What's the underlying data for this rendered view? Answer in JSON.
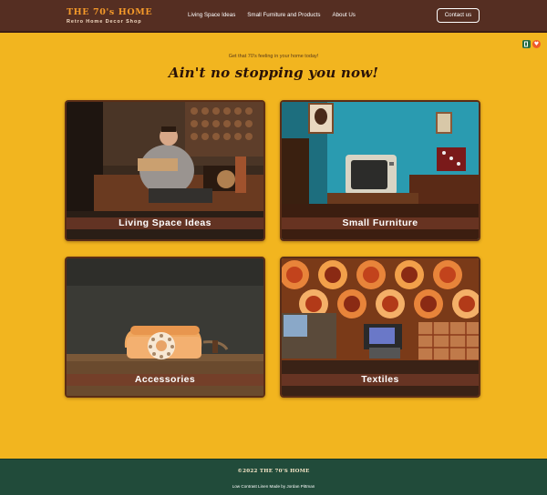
{
  "header": {
    "brand_title": "THE 70's HOME",
    "brand_subtitle": "Retro Home Decor Shop",
    "nav": [
      "Living Space Ideas",
      "Small Furniture and Products",
      "About Us"
    ],
    "contact_label": "Contact us"
  },
  "hero": {
    "tagline": "Get that 70's feeling in your home today!",
    "headline": "Ain't no stopping you now!"
  },
  "cards": [
    {
      "label": "Living Space Ideas"
    },
    {
      "label": "Small Furniture"
    },
    {
      "label": "Accessories"
    },
    {
      "label": "Textiles"
    }
  ],
  "footer": {
    "copyright": "©2022 THE 70'S HOME",
    "credit": "Low Contrast Linen Made by Jordan Pittman"
  },
  "colors": {
    "page_bg": "#f2b51f",
    "header_bg": "#552e22",
    "footer_bg": "#214b3a",
    "brand_accent": "#f59a2a",
    "card_border": "#5a2d16"
  },
  "icons": [
    "extension-door-icon",
    "extension-heart-icon"
  ]
}
